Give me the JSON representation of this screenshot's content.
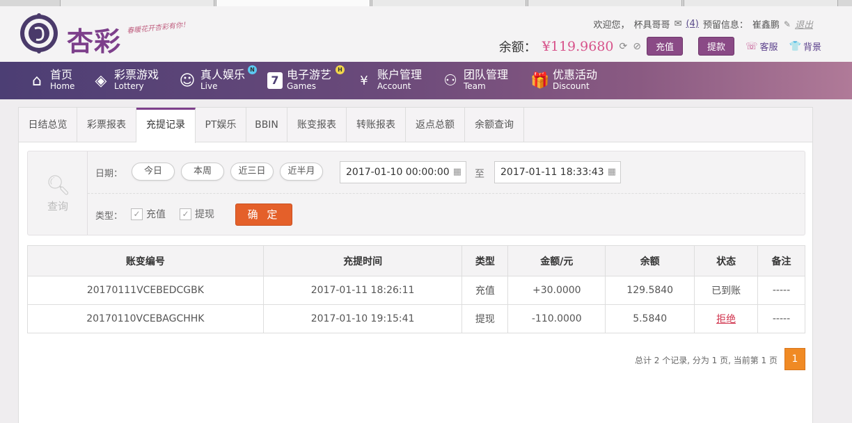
{
  "header": {
    "logo_text": "杏彩",
    "logo_slogan": "春暖花开杏彩有你！",
    "welcome": "欢迎您，",
    "username": "杯具哥哥",
    "mail_count": "(4)",
    "reserve_label": "预留信息：",
    "reserve_value": "崔鑫鹏",
    "logout": "退出",
    "balance_label": "余额：",
    "balance_value": "¥119.9680",
    "recharge_btn": "充值",
    "withdraw_btn": "提款",
    "service": "客服",
    "skin": "背景"
  },
  "nav": [
    {
      "zh": "首页",
      "en": "Home",
      "icon": "home-icon"
    },
    {
      "zh": "彩票游戏",
      "en": "Lottery",
      "icon": "ticket-icon"
    },
    {
      "zh": "真人娱乐",
      "en": "Live",
      "icon": "person-icon",
      "badge": "N"
    },
    {
      "zh": "电子游艺",
      "en": "Games",
      "icon": "slot-icon",
      "badge": "H"
    },
    {
      "zh": "账户管理",
      "en": "Account",
      "icon": "yen-icon"
    },
    {
      "zh": "团队管理",
      "en": "Team",
      "icon": "team-icon"
    },
    {
      "zh": "优惠活动",
      "en": "Discount",
      "icon": "gift-icon"
    }
  ],
  "subtabs": [
    "日结总览",
    "彩票报表",
    "充提记录",
    "PT娱乐",
    "BBIN",
    "账变报表",
    "转账报表",
    "返点总额",
    "余额查询"
  ],
  "active_subtab": "充提记录",
  "query": {
    "label": "查询",
    "date_label": "日期：",
    "ranges": [
      "今日",
      "本周",
      "近三日",
      "近半月"
    ],
    "start": "2017-01-10 00:00:00",
    "to": "至",
    "end": "2017-01-11 18:33:43",
    "type_label": "类型：",
    "types": [
      "充值",
      "提现"
    ],
    "submit": "确 定"
  },
  "table": {
    "headers": [
      "账变编号",
      "充提时间",
      "类型",
      "金额/元",
      "余额",
      "状态",
      "备注"
    ],
    "rows": [
      {
        "id": "20170111VCEBEDCGBK",
        "time": "2017-01-11 18:26:11",
        "type": "充值",
        "amount": "+30.0000",
        "balance": "129.5840",
        "status": "已到账",
        "note": "-----"
      },
      {
        "id": "20170110VCEBAGCHHK",
        "time": "2017-01-10 19:15:41",
        "type": "提现",
        "amount": "-110.0000",
        "balance": "5.5840",
        "status": "拒绝",
        "note": "-----"
      }
    ]
  },
  "pager": {
    "info": "总计 2 个记录, 分为 1 页, 当前第 1 页",
    "current": "1"
  },
  "colors": {
    "brand": "#7d3f8b",
    "accent": "#e4602a",
    "positive": "#d0334d",
    "negative": "#2e8b2e"
  }
}
